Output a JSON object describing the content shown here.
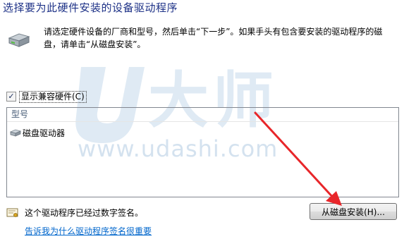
{
  "title": "选择要为此硬件安装的设备驱动程序",
  "intro_text": "请选定硬件设备的厂商和型号，然后单击“下一步”。如果手头有包含要安装的驱动程序的磁盘，请单击“从磁盘安装”。",
  "watermark": {
    "brand": "大师",
    "url": "www.udashi.com"
  },
  "compat": {
    "checked": true,
    "check_mark": "✓",
    "label": "显示兼容硬件(C)"
  },
  "model_list": {
    "header": "型号",
    "items": [
      {
        "label": "磁盘驱动器"
      }
    ]
  },
  "signature": {
    "status": "这个驱动程序已经过数字签名。",
    "link": "告诉我为什么驱动程序签名很重要"
  },
  "buttons": {
    "have_disk": "从磁盘安装(H)..."
  },
  "colors": {
    "title": "#1e3287",
    "link": "#0066cc",
    "arrow": "#e8262a",
    "watermark": "#dfeaf4"
  },
  "icons": {
    "hardware": "hard-drive-icon",
    "list_item": "disk-drive-icon",
    "signature": "certificate-icon"
  }
}
